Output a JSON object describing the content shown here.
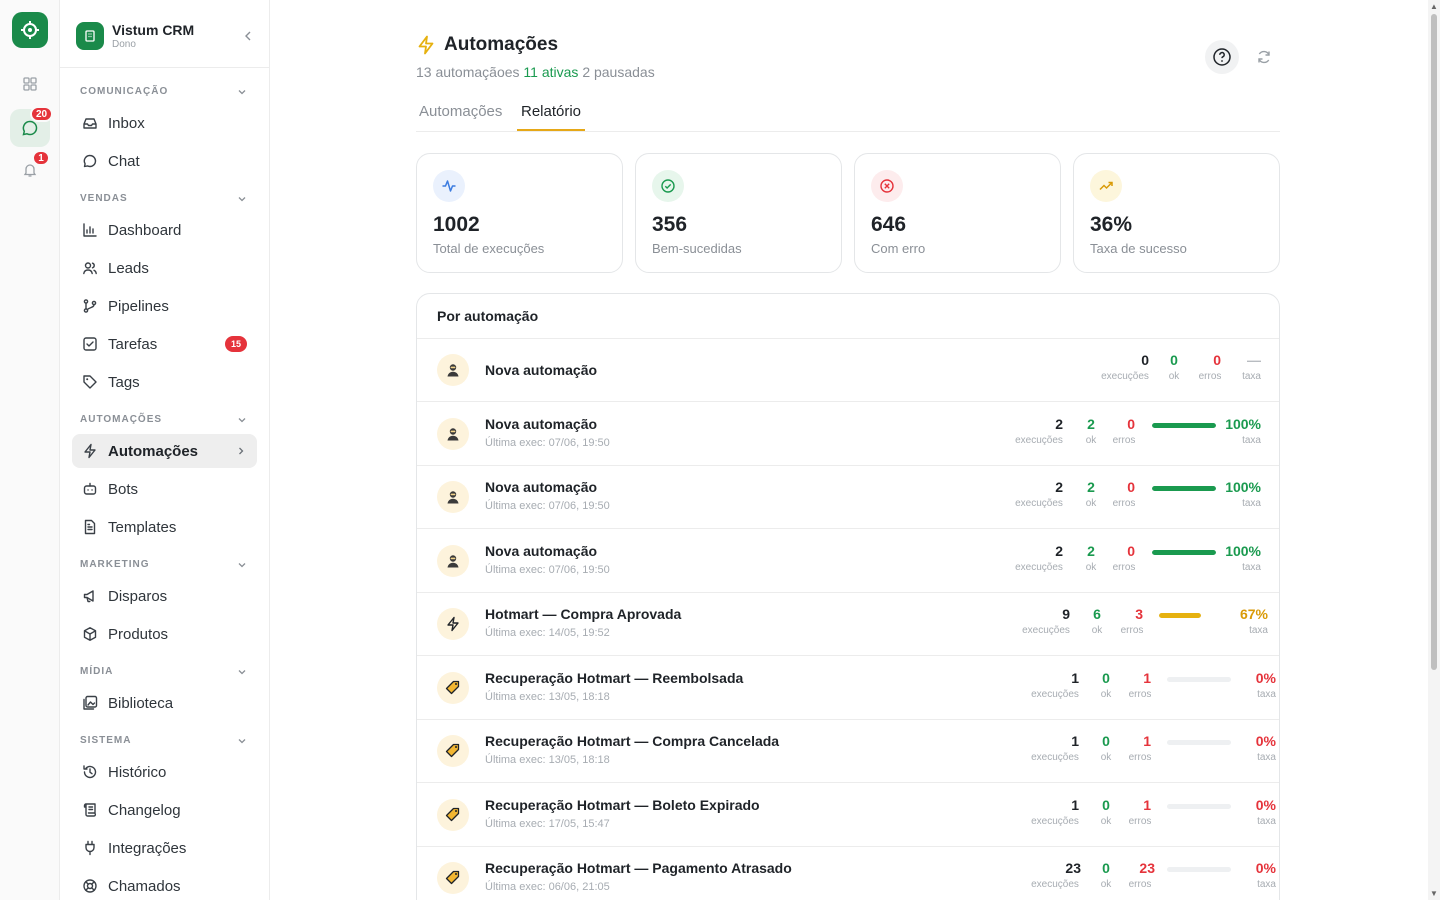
{
  "rail": {
    "logo_icon": "target-icon",
    "items": [
      {
        "icon": "grid-icon"
      },
      {
        "icon": "chat-bubble-icon",
        "badge": "20"
      },
      {
        "icon": "bell-icon",
        "badge": "1"
      }
    ]
  },
  "sidebar": {
    "org_name": "Vistum CRM",
    "org_role": "Dono",
    "sections": [
      {
        "title": "COMUNICAÇÃO",
        "items": [
          {
            "label": "Inbox"
          },
          {
            "label": "Chat"
          }
        ]
      },
      {
        "title": "VENDAS",
        "items": [
          {
            "label": "Dashboard"
          },
          {
            "label": "Leads"
          },
          {
            "label": "Pipelines"
          },
          {
            "label": "Tarefas",
            "badge": "15"
          },
          {
            "label": "Tags"
          }
        ]
      },
      {
        "title": "AUTOMAÇÕES",
        "items": [
          {
            "label": "Automações",
            "active": true
          },
          {
            "label": "Bots"
          },
          {
            "label": "Templates"
          }
        ]
      },
      {
        "title": "MARKETING",
        "items": [
          {
            "label": "Disparos"
          },
          {
            "label": "Produtos"
          }
        ]
      },
      {
        "title": "MÍDIA",
        "items": [
          {
            "label": "Biblioteca"
          }
        ]
      },
      {
        "title": "SISTEMA",
        "items": [
          {
            "label": "Histórico"
          },
          {
            "label": "Changelog"
          },
          {
            "label": "Integrações"
          },
          {
            "label": "Chamados"
          }
        ]
      }
    ]
  },
  "header": {
    "title": "Automações",
    "subtitle_total": "13 automaçãoes",
    "subtitle_active": "11 ativas",
    "subtitle_paused": "2 pausadas"
  },
  "tabs": [
    "Automações",
    "Relatório"
  ],
  "colors": {
    "accent": "#1a8a4a",
    "success": "#1a9a4f",
    "error": "#e5333b",
    "warning": "#e6b10f",
    "tab_underline": "#e6a817"
  },
  "stats": [
    {
      "icon": "activity-icon",
      "value": "1002",
      "label": "Total de execuções"
    },
    {
      "icon": "check-circle-icon",
      "value": "356",
      "label": "Bem-sucedidas"
    },
    {
      "icon": "x-circle-icon",
      "value": "646",
      "label": "Com erro"
    },
    {
      "icon": "trending-up-icon",
      "value": "36%",
      "label": "Taxa de sucesso"
    }
  ],
  "report": {
    "title": "Por automação",
    "labels": {
      "exec": "execuções",
      "ok": "ok",
      "errors": "erros",
      "rate": "taxa"
    },
    "rows": [
      {
        "icon": "robot-icon",
        "name": "Nova automação",
        "last": "",
        "exec": "0",
        "ok": "0",
        "errors": "0",
        "rate": "—",
        "rate_value": null
      },
      {
        "icon": "robot-icon",
        "name": "Nova automação",
        "last": "Última exec: 07/06, 19:50",
        "exec": "2",
        "ok": "2",
        "errors": "0",
        "rate": "100%",
        "rate_value": 100
      },
      {
        "icon": "robot-icon",
        "name": "Nova automação",
        "last": "Última exec: 07/06, 19:50",
        "exec": "2",
        "ok": "2",
        "errors": "0",
        "rate": "100%",
        "rate_value": 100
      },
      {
        "icon": "robot-icon",
        "name": "Nova automação",
        "last": "Última exec: 07/06, 19:50",
        "exec": "2",
        "ok": "2",
        "errors": "0",
        "rate": "100%",
        "rate_value": 100
      },
      {
        "icon": "lightning-icon",
        "name": "Hotmart — Compra Aprovada",
        "last": "Última exec: 14/05, 19:52",
        "exec": "9",
        "ok": "6",
        "errors": "3",
        "rate": "67%",
        "rate_value": 67
      },
      {
        "icon": "tag-icon",
        "name": "Recuperação Hotmart — Reembolsada",
        "last": "Última exec: 13/05, 18:18",
        "exec": "1",
        "ok": "0",
        "errors": "1",
        "rate": "0%",
        "rate_value": 0
      },
      {
        "icon": "tag-icon",
        "name": "Recuperação Hotmart — Compra Cancelada",
        "last": "Última exec: 13/05, 18:18",
        "exec": "1",
        "ok": "0",
        "errors": "1",
        "rate": "0%",
        "rate_value": 0
      },
      {
        "icon": "tag-icon",
        "name": "Recuperação Hotmart — Boleto Expirado",
        "last": "Última exec: 17/05, 15:47",
        "exec": "1",
        "ok": "0",
        "errors": "1",
        "rate": "0%",
        "rate_value": 0
      },
      {
        "icon": "tag-icon",
        "name": "Recuperação Hotmart — Pagamento Atrasado",
        "last": "Última exec: 06/06, 21:05",
        "exec": "23",
        "ok": "0",
        "errors": "23",
        "rate": "0%",
        "rate_value": 0
      }
    ]
  }
}
